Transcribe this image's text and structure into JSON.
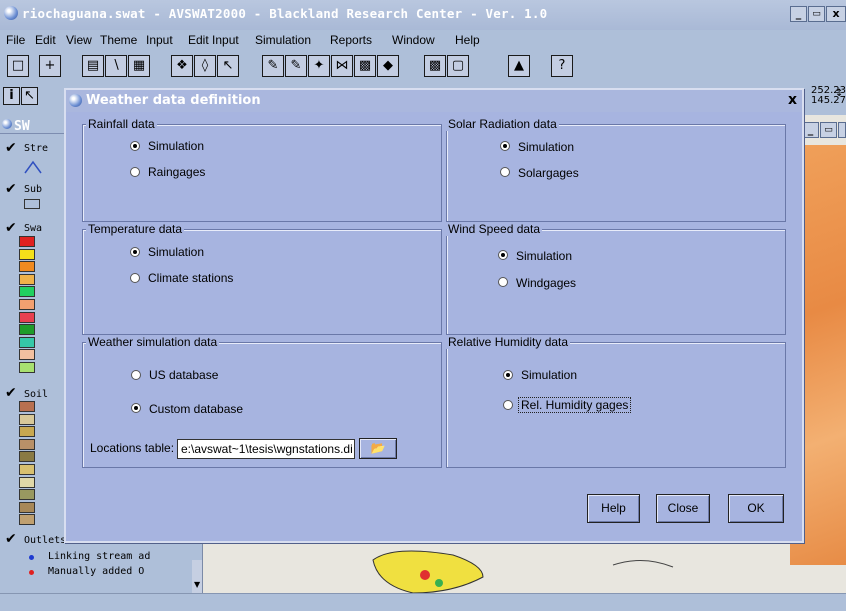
{
  "app": {
    "title": "riochaguana.swat - AVSWAT2000 - Blackland Research Center - Ver. 1.0",
    "window_buttons": [
      "_",
      "Ѧ",
      "x"
    ]
  },
  "menubar": [
    "File",
    "Edit",
    "View",
    "Theme",
    "Input",
    "Edit Input",
    "Simulation",
    "Reports",
    "Window",
    "Help"
  ],
  "coords": {
    "x": "252.23",
    "y": "145.27"
  },
  "legend": {
    "title": "SW",
    "themes": [
      {
        "label": "Stre"
      },
      {
        "label": "Sub"
      },
      {
        "label": "Swa"
      },
      {
        "label": "Soil"
      },
      {
        "label": "Outlets"
      }
    ],
    "outlet_items": [
      "Linking stream ad",
      "Manually added O"
    ],
    "swat_colors": [
      "#e02020",
      "#f4e01a",
      "#f08a20",
      "#f0b24a",
      "#20d060",
      "#f3a070",
      "#e84050",
      "#1f9c2a",
      "#35c8a8",
      "#f3c0a0",
      "#a8e070"
    ],
    "soil_colors": [
      "#b87050",
      "#d8c898",
      "#c8a850",
      "#b89068",
      "#8a7a44",
      "#d8c070",
      "#e0d8a8",
      "#989860",
      "#a88858",
      "#c0a070"
    ]
  },
  "dialog": {
    "title": "Weather data definition",
    "close": "x",
    "rainfall": {
      "label": "Rainfall data",
      "options": [
        "Simulation",
        "Raingages"
      ],
      "selected": 0
    },
    "solar": {
      "label": "Solar Radiation data",
      "options": [
        "Simulation",
        "Solargages"
      ],
      "selected": 0
    },
    "temperature": {
      "label": "Temperature data",
      "options": [
        "Simulation",
        "Climate stations"
      ],
      "selected": 0
    },
    "wind": {
      "label": "Wind Speed data",
      "options": [
        "Simulation",
        "Windgages"
      ],
      "selected": 0
    },
    "weather_sim": {
      "label": "Weather simulation data",
      "options": [
        "US database",
        "Custom database"
      ],
      "selected": 1
    },
    "humidity": {
      "label": "Relative Humidity data",
      "options": [
        "Simulation",
        "Rel. Humidity gages"
      ],
      "selected": 0
    },
    "locations_label": "Locations table:",
    "locations_value": "e:\\avswat~1\\tesis\\wgnstations.di",
    "buttons": {
      "help": "Help",
      "close": "Close",
      "ok": "OK"
    }
  }
}
